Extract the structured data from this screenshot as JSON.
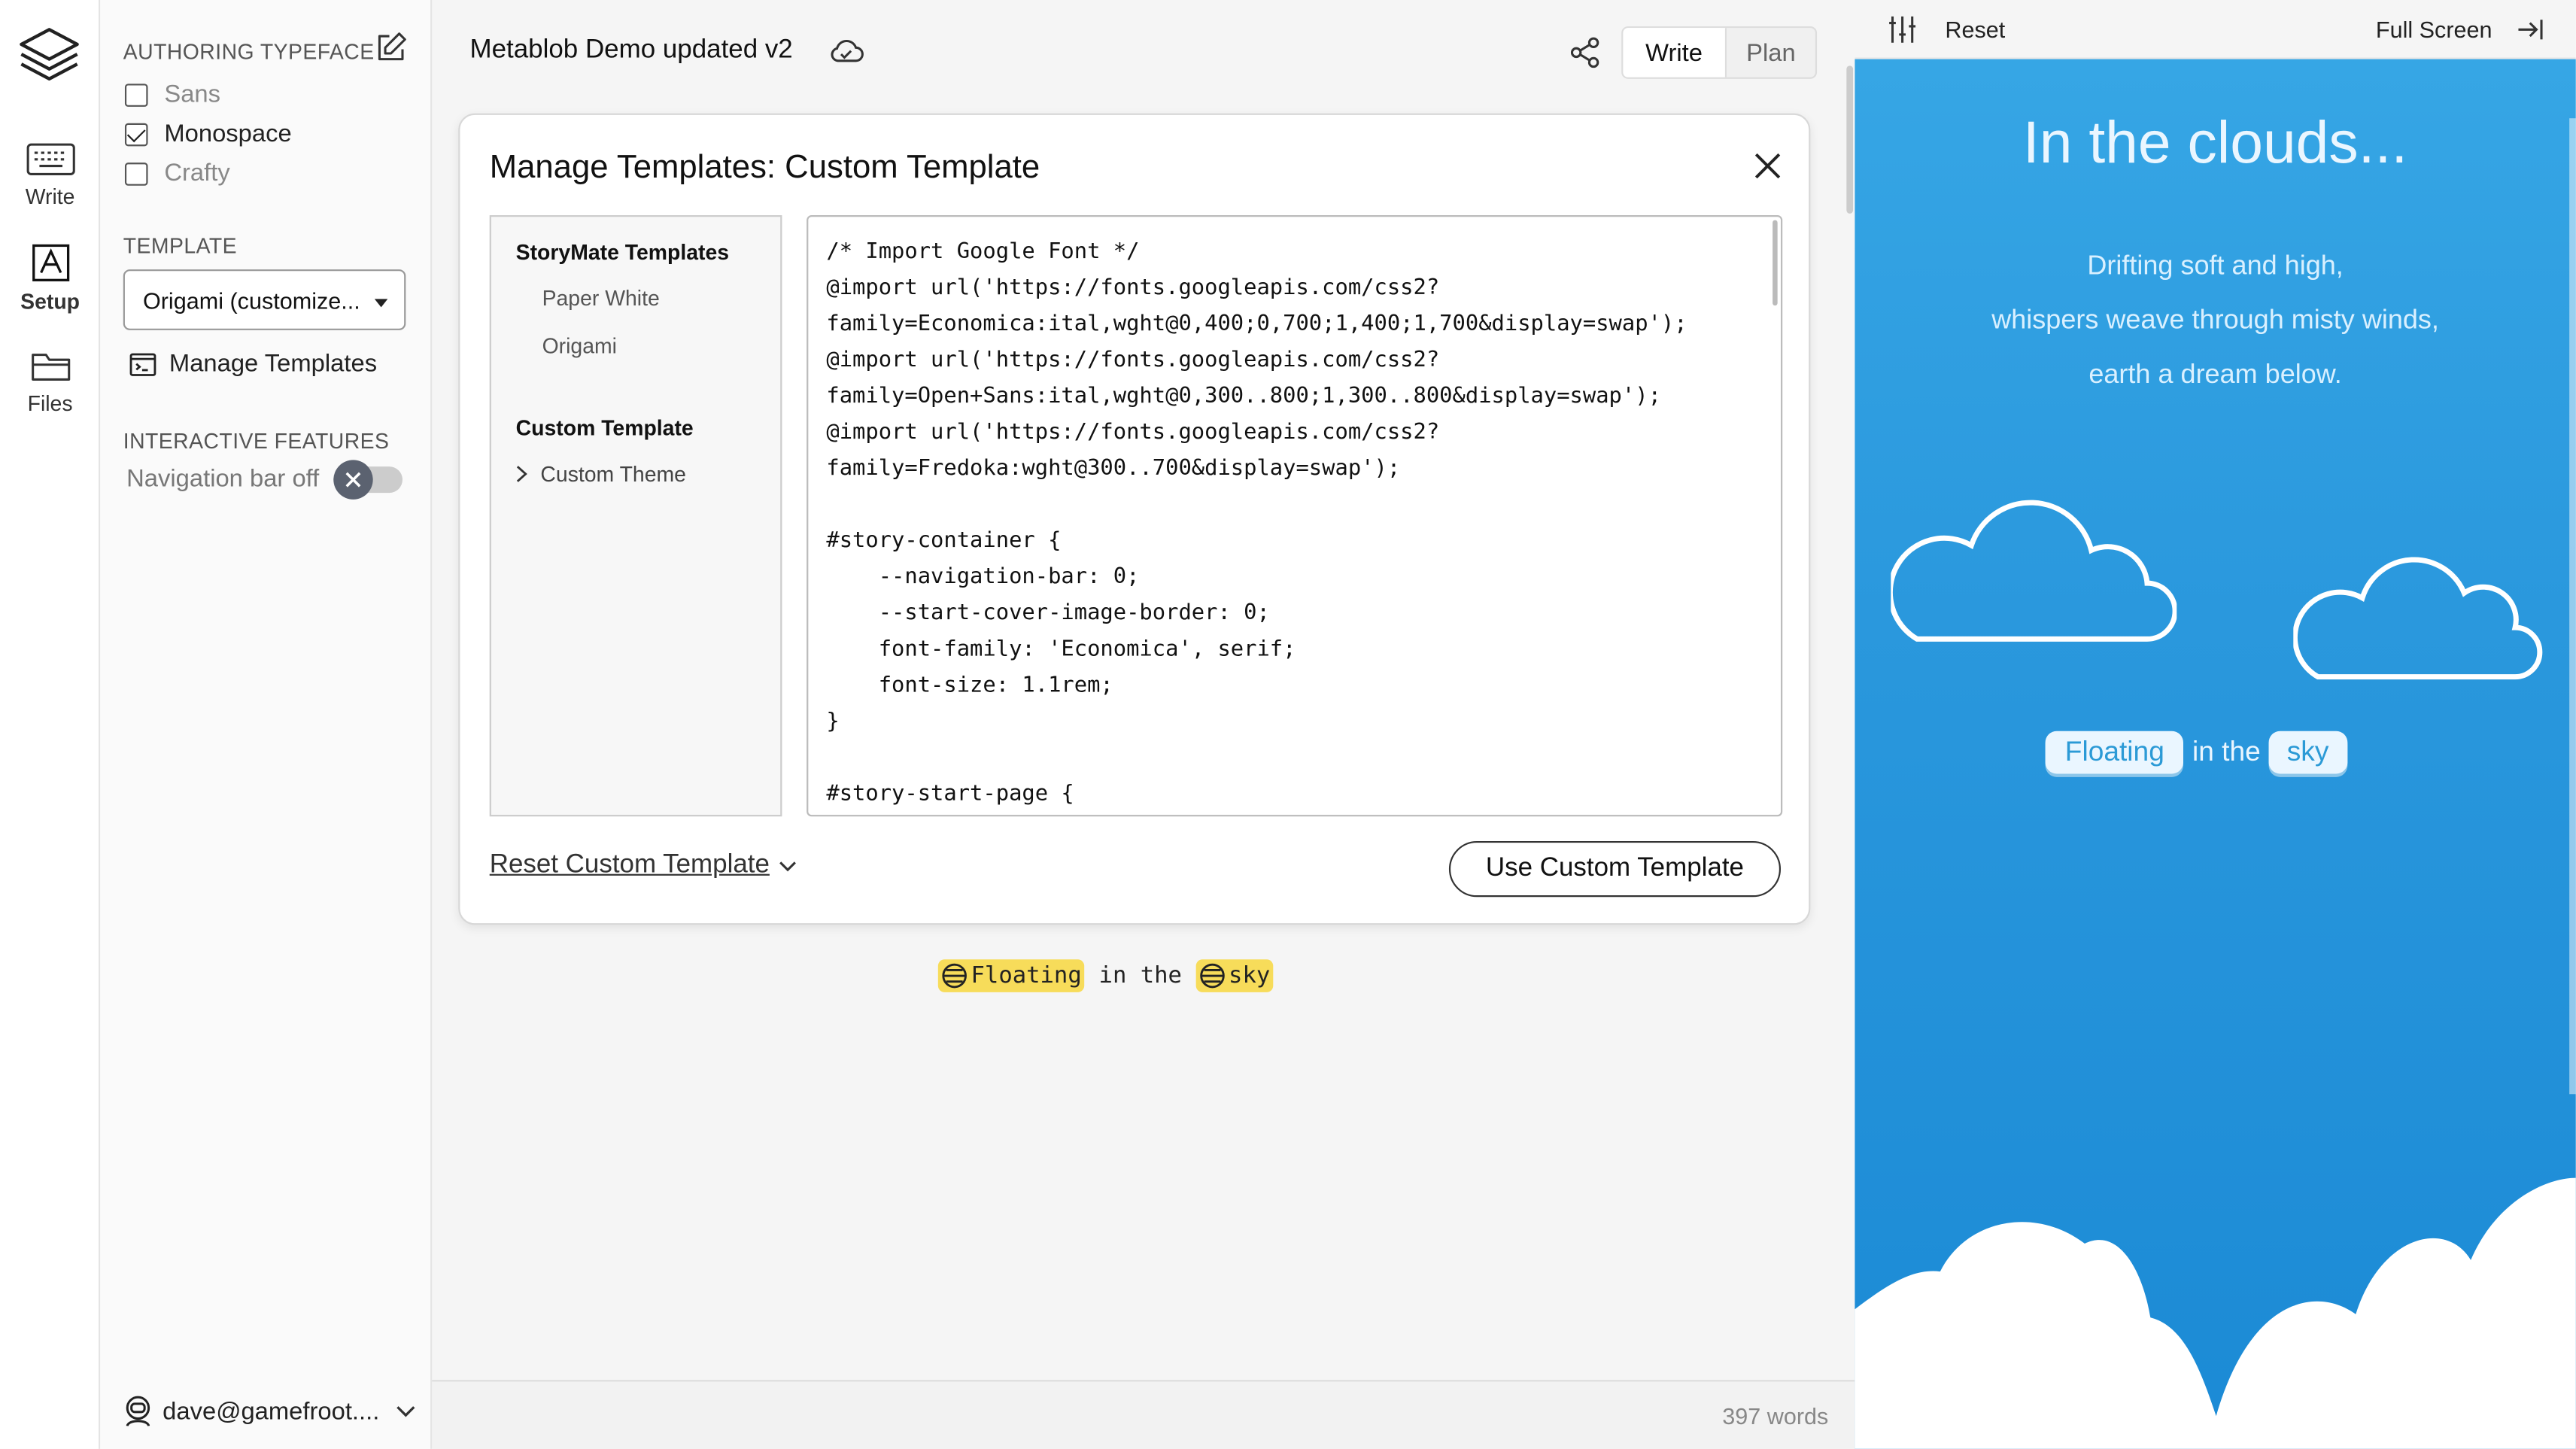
{
  "rail": {
    "items": [
      {
        "label": "Write"
      },
      {
        "label": "Setup"
      },
      {
        "label": "Files"
      }
    ]
  },
  "settings": {
    "typeface_title": "AUTHORING TYPEFACE",
    "typefaces": [
      {
        "label": "Sans",
        "checked": false
      },
      {
        "label": "Monospace",
        "checked": true
      },
      {
        "label": "Crafty",
        "checked": false
      }
    ],
    "template_title": "TEMPLATE",
    "template_selected": "Origami (customize...",
    "manage_label": "Manage Templates",
    "interactive_title": "INTERACTIVE FEATURES",
    "nav_toggle_label": "Navigation bar off",
    "user": "dave@gamefroot...."
  },
  "editor": {
    "doc_title": "Metablob Demo updated v2",
    "mode_write": "Write",
    "mode_plan": "Plan",
    "word_count": "397 words",
    "story_line": {
      "tag1": "Floating",
      "middle": " in the ",
      "tag2": "sky"
    }
  },
  "modal": {
    "title": "Manage Templates: Custom Template",
    "group_storymate": "StoryMate Templates",
    "item_paper": "Paper White",
    "item_origami": "Origami",
    "group_custom": "Custom Template",
    "item_theme": "Custom Theme",
    "code": "/* Import Google Font */\n@import url('https://fonts.googleapis.com/css2?\nfamily=Economica:ital,wght@0,400;0,700;1,400;1,700&display=swap');\n@import url('https://fonts.googleapis.com/css2?\nfamily=Open+Sans:ital,wght@0,300..800;1,300..800&display=swap');\n@import url('https://fonts.googleapis.com/css2?\nfamily=Fredoka:wght@300..700&display=swap');\n\n#story-container {\n    --navigation-bar: 0;\n    --start-cover-image-border: 0;\n    font-family: 'Economica', serif;\n    font-size: 1.1rem;\n}\n\n#story-start-page {",
    "reset_label": "Reset Custom Template",
    "use_label": "Use Custom Template"
  },
  "preview": {
    "reset": "Reset",
    "fullscreen": "Full Screen",
    "title": "In the clouds...",
    "poem": [
      "Drifting soft and high,",
      "whispers weave through misty winds,",
      "earth a dream below."
    ],
    "link1": "Floating",
    "middle": "in the",
    "link2": "sky",
    "colors": {
      "sky_top": "#36a6e5",
      "sky_bottom": "#1b8ad5",
      "tag_yellow": "#f7dc5a"
    }
  }
}
